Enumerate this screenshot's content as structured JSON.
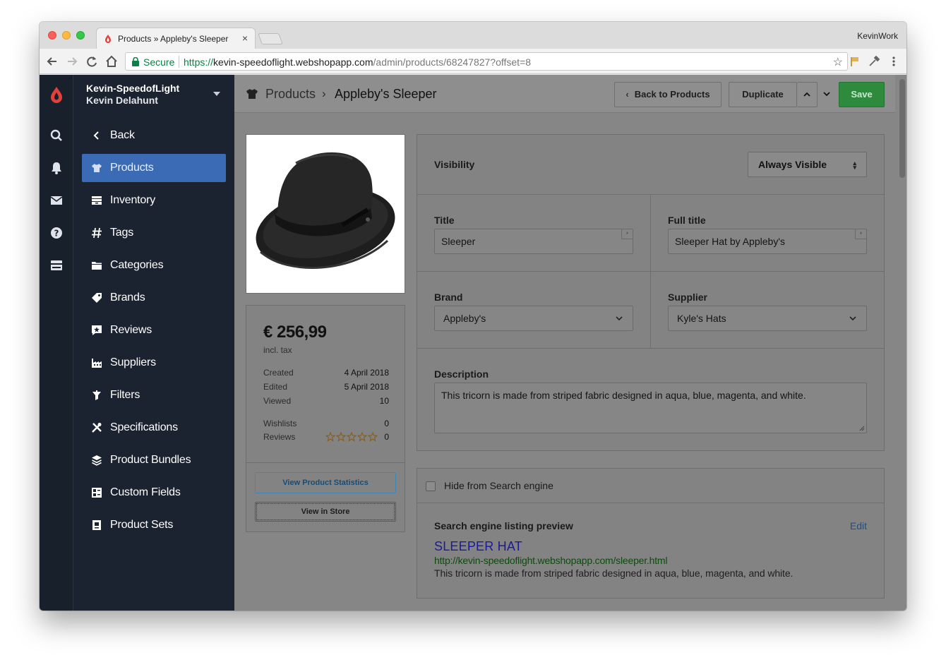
{
  "browser": {
    "tab_title": "Products » Appleby's Sleeper",
    "profile": "KevinWork",
    "secure_label": "Secure",
    "url_scheme": "https://",
    "url_host": "kevin-speedoflight.webshopapp.com",
    "url_path": "/admin/products/68247827?offset=8"
  },
  "shop": {
    "name": "Kevin-SpeedofLight",
    "user": "Kevin Delahunt"
  },
  "rail": [
    "search-icon",
    "bell-icon",
    "mail-icon",
    "help-icon",
    "billing-icon"
  ],
  "nav": [
    {
      "label": "Back",
      "icon": "chevron-left-icon"
    },
    {
      "label": "Products",
      "icon": "shirt-icon",
      "active": true
    },
    {
      "label": "Inventory",
      "icon": "inventory-icon"
    },
    {
      "label": "Tags",
      "icon": "hash-icon"
    },
    {
      "label": "Categories",
      "icon": "folder-icon"
    },
    {
      "label": "Brands",
      "icon": "tag-icon"
    },
    {
      "label": "Reviews",
      "icon": "review-star-icon"
    },
    {
      "label": "Suppliers",
      "icon": "factory-icon"
    },
    {
      "label": "Filters",
      "icon": "filter-icon"
    },
    {
      "label": "Specifications",
      "icon": "tools-icon"
    },
    {
      "label": "Product Bundles",
      "icon": "layers-icon"
    },
    {
      "label": "Custom Fields",
      "icon": "custom-fields-icon"
    },
    {
      "label": "Product Sets",
      "icon": "product-sets-icon"
    }
  ],
  "breadcrumb": {
    "section": "Products",
    "current": "Appleby's Sleeper"
  },
  "actions": {
    "back": "Back to Products",
    "duplicate": "Duplicate",
    "save": "Save"
  },
  "summary": {
    "price": "€ 256,99",
    "price_note": "incl. tax",
    "created_label": "Created",
    "created": "4 April 2018",
    "edited_label": "Edited",
    "edited": "5 April 2018",
    "viewed_label": "Viewed",
    "viewed": "10",
    "wishlists_label": "Wishlists",
    "wishlists": "0",
    "reviews_label": "Reviews",
    "reviews": "0",
    "rating": 0,
    "view_stats": "View Product Statistics",
    "view_store": "View in Store"
  },
  "form": {
    "visibility_label": "Visibility",
    "visibility": "Always Visible",
    "title_label": "Title",
    "title": "Sleeper",
    "full_title_label": "Full title",
    "full_title": "Sleeper Hat by Appleby's",
    "brand_label": "Brand",
    "brand": "Appleby's",
    "supplier_label": "Supplier",
    "supplier": "Kyle's Hats",
    "description_label": "Description",
    "description": "This tricorn is made from striped fabric designed in aqua, blue, magenta, and white."
  },
  "seo": {
    "hide_label": "Hide from Search engine",
    "preview_label": "Search engine listing preview",
    "edit": "Edit",
    "title": "SLEEPER HAT",
    "url": "http://kevin-speedoflight.webshopapp.com/sleeper.html",
    "description": "This tricorn is made from striped fabric designed in aqua, blue, magenta, and white."
  },
  "colors": {
    "sidebar": "#1b2230",
    "active_nav": "#3a6bb4",
    "save": "#2e8b3e",
    "brand": "#e2413b"
  }
}
